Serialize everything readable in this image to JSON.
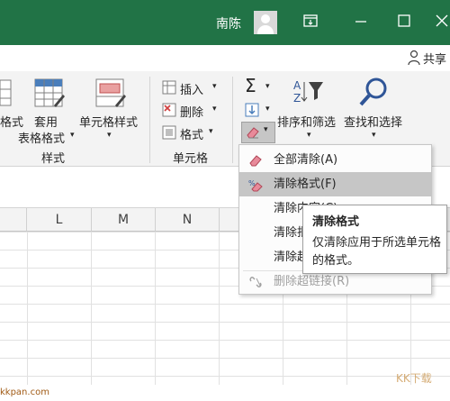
{
  "titlebar": {
    "user_name": "南陈"
  },
  "share": {
    "label": "共享"
  },
  "ribbon": {
    "styles_group": {
      "format_partial": "格式",
      "table_format_line1": "套用",
      "table_format_line2": "表格格式",
      "cell_styles": "单元格样式",
      "group_label": "样式"
    },
    "cells_group": {
      "insert": "插入",
      "delete": "删除",
      "format": "格式",
      "group_label": "单元格"
    },
    "editing_group": {
      "sort_filter": "排序和筛选",
      "find_select": "查找和选择"
    }
  },
  "columns": [
    "L",
    "M",
    "N"
  ],
  "clear_menu": {
    "items": [
      {
        "label": "全部清除(A)",
        "state": "normal"
      },
      {
        "label": "清除格式(F)",
        "state": "highlighted"
      },
      {
        "label": "清除内容(C)",
        "state": "normal"
      },
      {
        "label": "清除批注(M)",
        "state": "normal"
      },
      {
        "label": "清除超链接(不含格式)(L)",
        "state": "normal"
      },
      {
        "label": "删除超链接(R)",
        "state": "disabled"
      }
    ]
  },
  "tooltip": {
    "title": "清除格式",
    "body": "仅清除应用于所选单元格的格式。"
  },
  "watermark": {
    "left": "kkpan.com",
    "right": "KK下载"
  }
}
